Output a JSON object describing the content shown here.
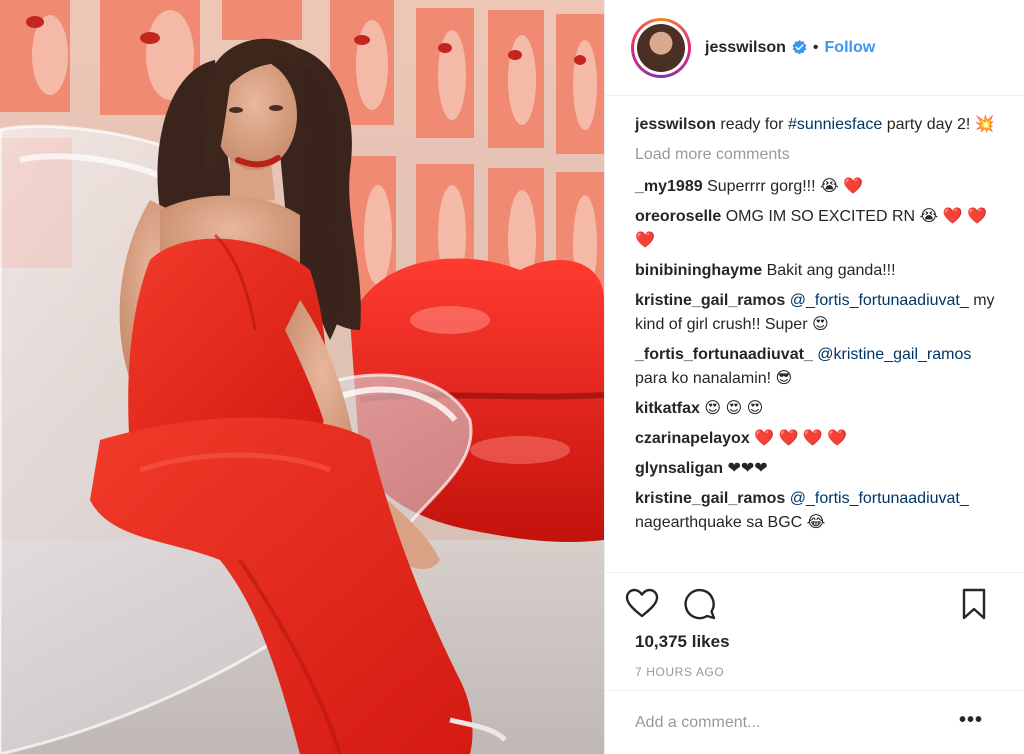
{
  "post": {
    "username": "jesswilson",
    "follow_label": "Follow",
    "separator": "•",
    "caption": {
      "username": "jesswilson",
      "text_before": " ready for ",
      "hashtag": "#sunniesface",
      "text_after": " party day 2! 💥"
    },
    "load_more": "Load more comments",
    "likes": "10,375 likes",
    "time": "7 HOURS AGO",
    "add_comment_placeholder": "Add a comment...",
    "more_options": "•••"
  },
  "comments": [
    {
      "user": "_my1989",
      "pre": " Superrrr gorg!!! ",
      "mention": "",
      "post": "😭 ❤️"
    },
    {
      "user": "oreoroselle",
      "pre": " OMG IM SO EXCITED RN 😭 ❤️ ❤️ ❤️",
      "mention": "",
      "post": ""
    },
    {
      "user": "binibininghayme",
      "pre": " Bakit ang ganda!!!",
      "mention": "",
      "post": ""
    },
    {
      "user": "kristine_gail_ramos",
      "pre": " ",
      "mention": "@_fortis_fortunaadiuvat_",
      "post": " my kind of girl crush!! Super 😍"
    },
    {
      "user": "_fortis_fortunaadiuvat_",
      "pre": " ",
      "mention": "@kristine_gail_ramos",
      "post": " para ko nanalamin! 😎"
    },
    {
      "user": "kitkatfax",
      "pre": " 😍 😍 😍",
      "mention": "",
      "post": ""
    },
    {
      "user": "czarinapelayox",
      "pre": " ❤️ ❤️ ❤️ ❤️",
      "mention": "",
      "post": ""
    },
    {
      "user": "glynsaligan",
      "pre": " ❤❤❤",
      "mention": "",
      "post": ""
    },
    {
      "user": "kristine_gail_ramos",
      "pre": " ",
      "mention": "@_fortis_fortunaadiuvat_",
      "post": " nagearthquake sa BGC 😂"
    }
  ],
  "icons": {
    "like": "heart-icon",
    "comment": "comment-bubble-icon",
    "save": "bookmark-icon",
    "verified": "verified-badge-icon"
  },
  "colors": {
    "link": "#003569",
    "follow": "#3897f0",
    "muted": "#999999",
    "text": "#262626",
    "dress_red": "#e8251c"
  }
}
